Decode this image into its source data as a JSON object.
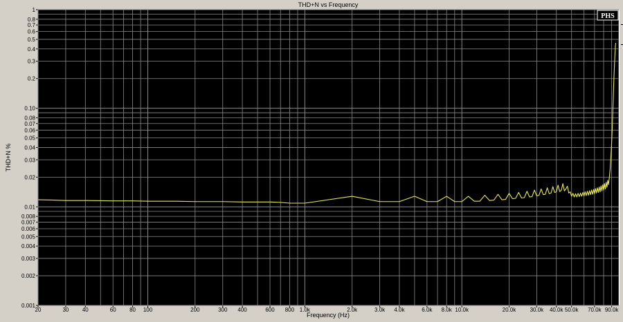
{
  "chart_data": {
    "type": "line",
    "title": "THD+N vs Frequency",
    "xlabel": "Frequency (Hz)",
    "ylabel": "THD+N %",
    "x_scale": "log",
    "y_scale": "log",
    "xlim": [
      20,
      100000
    ],
    "ylim": [
      0.001,
      1
    ],
    "grid": true,
    "badge": "PHS",
    "x_ticks": [
      {
        "value": 20,
        "label": "20"
      },
      {
        "value": 30,
        "label": "30"
      },
      {
        "value": 40,
        "label": "40"
      },
      {
        "value": 60,
        "label": "60"
      },
      {
        "value": 80,
        "label": "80"
      },
      {
        "value": 100,
        "label": "100"
      },
      {
        "value": 200,
        "label": "200"
      },
      {
        "value": 300,
        "label": "300"
      },
      {
        "value": 400,
        "label": "400"
      },
      {
        "value": 600,
        "label": "600"
      },
      {
        "value": 800,
        "label": "800"
      },
      {
        "value": 1000,
        "label": "1.0k"
      },
      {
        "value": 2000,
        "label": "2.0k"
      },
      {
        "value": 3000,
        "label": "3.0k"
      },
      {
        "value": 4000,
        "label": "4.0k"
      },
      {
        "value": 6000,
        "label": "6.0k"
      },
      {
        "value": 8000,
        "label": "8.0k"
      },
      {
        "value": 10000,
        "label": "10.0k"
      },
      {
        "value": 20000,
        "label": "20.0k"
      },
      {
        "value": 30000,
        "label": "30.0k"
      },
      {
        "value": 40000,
        "label": "40.0k"
      },
      {
        "value": 50000,
        "label": "50.0k"
      },
      {
        "value": 70000,
        "label": "70.0k"
      },
      {
        "value": 90000,
        "label": "90.0k"
      }
    ],
    "y_ticks": [
      {
        "value": 1,
        "label": "1"
      },
      {
        "value": 0.8,
        "label": "0.8"
      },
      {
        "value": 0.7,
        "label": "0.7"
      },
      {
        "value": 0.6,
        "label": "0.6"
      },
      {
        "value": 0.5,
        "label": "0.5"
      },
      {
        "value": 0.4,
        "label": "0.4"
      },
      {
        "value": 0.3,
        "label": "0.3"
      },
      {
        "value": 0.2,
        "label": "0.2"
      },
      {
        "value": 0.1,
        "label": "0.10"
      },
      {
        "value": 0.08,
        "label": "0.08"
      },
      {
        "value": 0.07,
        "label": "0.07"
      },
      {
        "value": 0.06,
        "label": "0.06"
      },
      {
        "value": 0.05,
        "label": "0.05"
      },
      {
        "value": 0.04,
        "label": "0.04"
      },
      {
        "value": 0.03,
        "label": "0.03"
      },
      {
        "value": 0.02,
        "label": "0.02"
      },
      {
        "value": 0.01,
        "label": "0.01"
      },
      {
        "value": 0.008,
        "label": "0.008"
      },
      {
        "value": 0.007,
        "label": "0.007"
      },
      {
        "value": 0.006,
        "label": "0.006"
      },
      {
        "value": 0.005,
        "label": "0.005"
      },
      {
        "value": 0.004,
        "label": "0.004"
      },
      {
        "value": 0.003,
        "label": "0.003"
      },
      {
        "value": 0.002,
        "label": "0.002"
      },
      {
        "value": 0.001,
        "label": "0.001"
      }
    ],
    "series": [
      {
        "color": "#e8e85a",
        "points": [
          [
            20,
            0.0118
          ],
          [
            25,
            0.0117
          ],
          [
            30,
            0.0116
          ],
          [
            40,
            0.0116
          ],
          [
            60,
            0.0115
          ],
          [
            80,
            0.0115
          ],
          [
            100,
            0.0114
          ],
          [
            150,
            0.0114
          ],
          [
            200,
            0.0113
          ],
          [
            300,
            0.0113
          ],
          [
            400,
            0.0112
          ],
          [
            500,
            0.0112
          ],
          [
            600,
            0.0112
          ],
          [
            700,
            0.0111
          ],
          [
            800,
            0.0109
          ],
          [
            1000,
            0.0109
          ],
          [
            2000,
            0.0128
          ],
          [
            3000,
            0.0113
          ],
          [
            4000,
            0.0113
          ],
          [
            5000,
            0.0128
          ],
          [
            6000,
            0.0113
          ],
          [
            7000,
            0.0113
          ],
          [
            8000,
            0.0128
          ],
          [
            9000,
            0.0113
          ],
          [
            10000,
            0.0113
          ],
          [
            11000,
            0.0128
          ],
          [
            12000,
            0.0114
          ],
          [
            13000,
            0.0114
          ],
          [
            14000,
            0.0131
          ],
          [
            15000,
            0.0116
          ],
          [
            16000,
            0.0117
          ],
          [
            17000,
            0.0134
          ],
          [
            18000,
            0.0118
          ],
          [
            19000,
            0.0119
          ],
          [
            20000,
            0.0137
          ],
          [
            21000,
            0.0121
          ],
          [
            22000,
            0.0122
          ],
          [
            23000,
            0.014
          ],
          [
            24000,
            0.0123
          ],
          [
            25000,
            0.0124
          ],
          [
            26000,
            0.0144
          ],
          [
            27000,
            0.0126
          ],
          [
            28000,
            0.0127
          ],
          [
            29000,
            0.0148
          ],
          [
            30000,
            0.0129
          ],
          [
            31000,
            0.0131
          ],
          [
            32000,
            0.0152
          ],
          [
            33000,
            0.0133
          ],
          [
            34000,
            0.0134
          ],
          [
            35000,
            0.0156
          ],
          [
            36000,
            0.0136
          ],
          [
            37000,
            0.0138
          ],
          [
            38000,
            0.016
          ],
          [
            39000,
            0.014
          ],
          [
            40000,
            0.0142
          ],
          [
            41000,
            0.0166
          ],
          [
            42000,
            0.0143
          ],
          [
            43000,
            0.0147
          ],
          [
            44000,
            0.0172
          ],
          [
            45000,
            0.0145
          ],
          [
            46000,
            0.0152
          ],
          [
            47000,
            0.0162
          ],
          [
            48000,
            0.0138
          ],
          [
            49000,
            0.0142
          ],
          [
            50000,
            0.0128
          ],
          [
            51000,
            0.0137
          ],
          [
            52000,
            0.0126
          ],
          [
            53000,
            0.0136
          ],
          [
            54000,
            0.0126
          ],
          [
            55000,
            0.0137
          ],
          [
            56000,
            0.0127
          ],
          [
            57000,
            0.0138
          ],
          [
            58000,
            0.0128
          ],
          [
            59000,
            0.014
          ],
          [
            60000,
            0.0129
          ],
          [
            61000,
            0.0142
          ],
          [
            62000,
            0.013
          ],
          [
            63000,
            0.0144
          ],
          [
            64000,
            0.0131
          ],
          [
            65000,
            0.0146
          ],
          [
            66000,
            0.0133
          ],
          [
            67000,
            0.0148
          ],
          [
            68000,
            0.0134
          ],
          [
            69000,
            0.015
          ],
          [
            70000,
            0.0136
          ],
          [
            71000,
            0.0153
          ],
          [
            72000,
            0.0138
          ],
          [
            73000,
            0.0156
          ],
          [
            74000,
            0.014
          ],
          [
            75000,
            0.0159
          ],
          [
            76000,
            0.0142
          ],
          [
            77000,
            0.0163
          ],
          [
            78000,
            0.0145
          ],
          [
            79000,
            0.0167
          ],
          [
            80000,
            0.0148
          ],
          [
            81000,
            0.0172
          ],
          [
            82000,
            0.0152
          ],
          [
            83000,
            0.0178
          ],
          [
            84000,
            0.0158
          ],
          [
            85000,
            0.0186
          ],
          [
            86000,
            0.0168
          ],
          [
            87000,
            0.02
          ],
          [
            88000,
            0.024
          ],
          [
            89000,
            0.032
          ],
          [
            90000,
            0.045
          ],
          [
            91000,
            0.07
          ],
          [
            92000,
            0.12
          ],
          [
            93000,
            0.2
          ],
          [
            94000,
            0.3
          ],
          [
            95000,
            0.42
          ],
          [
            95500,
            0.46
          ]
        ]
      }
    ]
  }
}
